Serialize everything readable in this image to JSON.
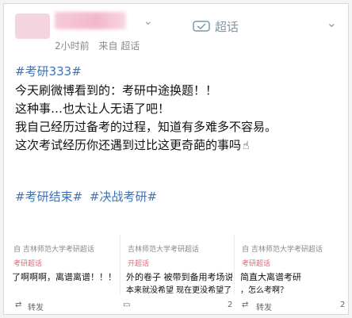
{
  "post": {
    "super_label": "超话",
    "time": "2小时前",
    "source": "来自 超话",
    "top_tag": "#考研333#",
    "lines": [
      "今天刷微博看到的：考研中途换题！！",
      "这种事…也太让人无语了吧！",
      "我自己经历过备考的过程，知道有多难多不容易。",
      "这次考试经历你还遇到过比这更奇葩的事吗"
    ],
    "bottom_tags": [
      "#考研结束#",
      "#决战考研#"
    ]
  },
  "thumbs": [
    {
      "top": "自 吉林师范大学考研超话",
      "mid": "考研超话",
      "main": "了啊啊啊，离谱离谱！！！",
      "main2": "",
      "repost": "转发"
    },
    {
      "top": "吉林师范大学考研超话",
      "mid": "开超话",
      "main": "外的卷子 被带到备用考场说换",
      "main2": "本来就没希望 现在更没希望了",
      "repost": "2"
    },
    {
      "top": "自 吉林师范大学考研超话",
      "mid": "考研超话",
      "main": "简直大离谱考研",
      "main2": "，怎么考啊？",
      "repost": "转发"
    }
  ],
  "footer": {
    "repost": "转发",
    "count_1": "2",
    "count_2": "2"
  }
}
